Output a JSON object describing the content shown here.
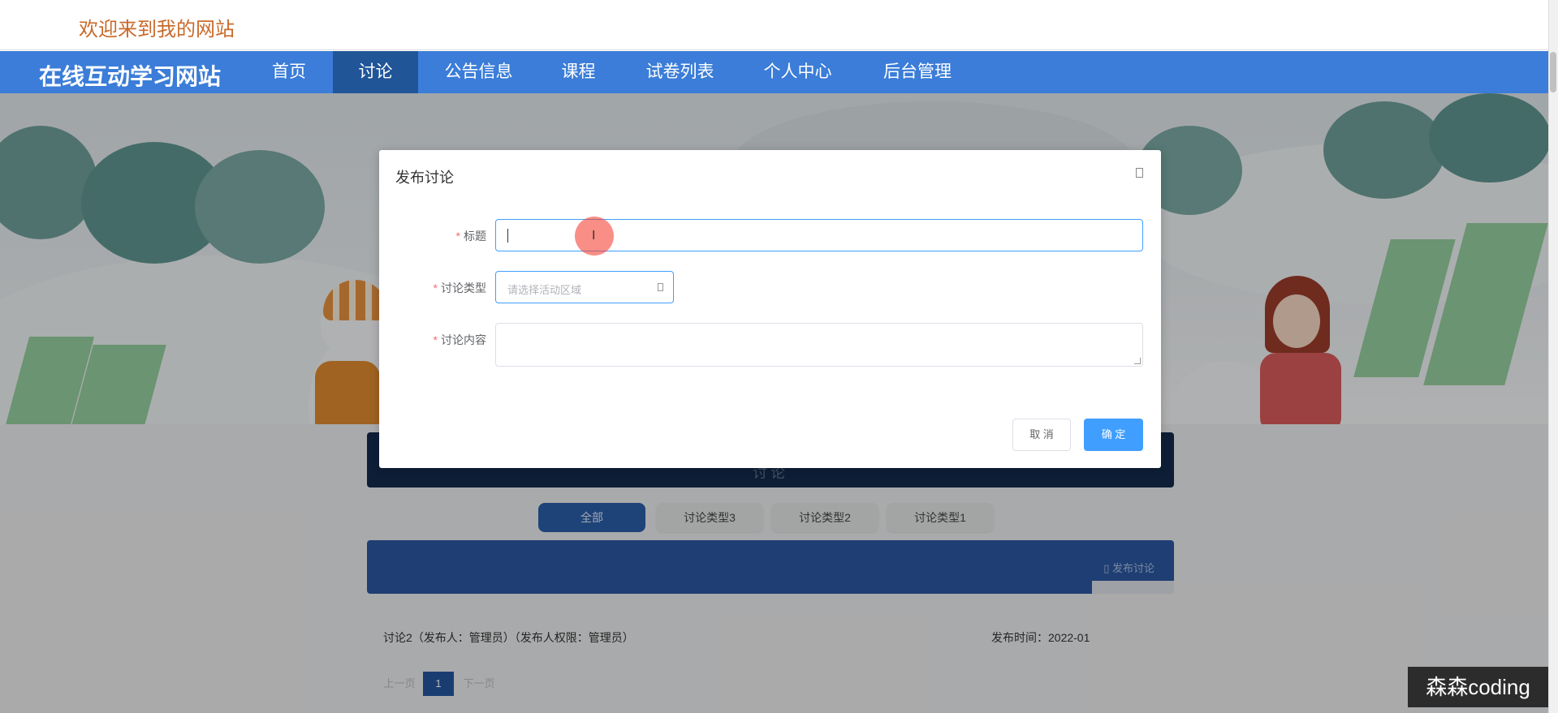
{
  "header": {
    "welcome": "欢迎来到我的网站"
  },
  "nav": {
    "site_name": "在线互动学习网站",
    "items": [
      {
        "label": "首页",
        "active": false
      },
      {
        "label": "讨论",
        "active": true
      },
      {
        "label": "公告信息",
        "active": false
      },
      {
        "label": "课程",
        "active": false
      },
      {
        "label": "试卷列表",
        "active": false
      },
      {
        "label": "个人中心",
        "active": false
      },
      {
        "label": "后台管理",
        "active": false
      }
    ]
  },
  "section": {
    "title": "讨论"
  },
  "filters": [
    {
      "label": "全部",
      "active": true
    },
    {
      "label": "讨论类型3",
      "active": false
    },
    {
      "label": "讨论类型2",
      "active": false
    },
    {
      "label": "讨论类型1",
      "active": false
    }
  ],
  "publish": {
    "label": "发布讨论"
  },
  "posts": [
    {
      "text": "讨论2（发布人：管理员）（发布人权限：管理员）",
      "time": "发布时间：2022-01"
    }
  ],
  "pagination": {
    "prev": "上一页",
    "current": "1",
    "next": "下一页"
  },
  "modal": {
    "title": "发布讨论",
    "fields": {
      "title_label": "标题",
      "title_value": "",
      "type_label": "讨论类型",
      "type_placeholder": "请选择活动区域",
      "content_label": "讨论内容",
      "content_value": ""
    },
    "buttons": {
      "cancel": "取 消",
      "ok": "确 定"
    }
  },
  "watermark": "森森coding",
  "colors": {
    "nav": "#3b7dd8",
    "nav_active": "#205598",
    "primary": "#409eff",
    "welcome": "#c96a2b"
  }
}
